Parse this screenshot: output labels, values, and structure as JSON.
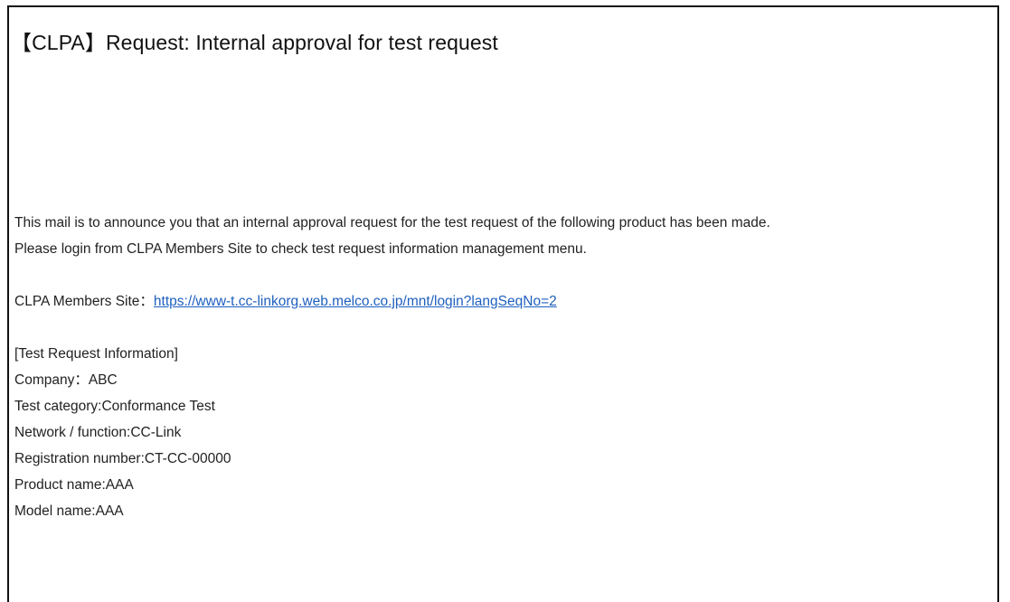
{
  "mail": {
    "subject": "【CLPA】Request: Internal approval for test request",
    "intro_line_1": "This mail is to announce you that an internal approval request for the test request of the following product has been made.",
    "intro_line_2": "Please login from CLPA Members Site to check test request information management menu.",
    "site_label": "CLPA Members Site：",
    "site_url": "https://www-t.cc-linkorg.web.melco.co.jp/mnt/login?langSeqNo=2",
    "info_heading": "[Test Request Information]",
    "info_lines": [
      "Company：ABC",
      "Test category:Conformance Test",
      "Network / function:CC-Link",
      "Registration number:CT-CC-00000",
      "Product name:AAA",
      "Model name:AAA"
    ]
  },
  "colors": {
    "link": "#1f5fbf",
    "border": "#111111",
    "text": "#222222"
  }
}
